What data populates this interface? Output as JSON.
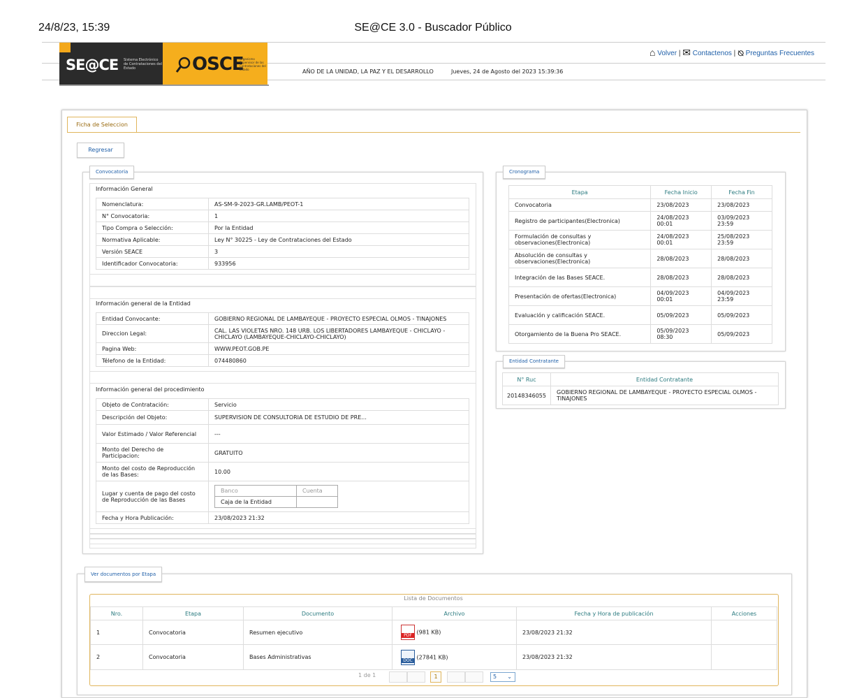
{
  "print": {
    "date": "24/8/23, 15:39",
    "title": "SE@CE 3.0 - Buscador Público"
  },
  "header": {
    "seace_logo": "SE@CE",
    "seace_logo_sub": "Sistema Electrónico de Contrataciones del Estado",
    "osce_logo": "OSCE",
    "osce_logo_sub": "Organismo Supervisor de las Contrataciones del Estado",
    "links": {
      "volver": "Volver",
      "contactenos": "Contactenos",
      "faq": "Preguntas Frecuentes",
      "sep": "|"
    },
    "motto": "AÑO DE LA UNIDAD, LA PAZ Y EL DESARROLLO",
    "datetime": "Jueves, 24 de Agosto del 2023 15:39:36"
  },
  "tab": {
    "label": "Ficha de Seleccion"
  },
  "regresar": "Regresar",
  "convocatoria": {
    "legend": "Convocatoria",
    "general_title": "Información General",
    "general": [
      {
        "k": "Nomenclatura:",
        "v": "AS-SM-9-2023-GR.LAMB/PEOT-1"
      },
      {
        "k": "N° Convocatoria:",
        "v": "1"
      },
      {
        "k": "Tipo Compra o Selección:",
        "v": "Por la Entidad"
      },
      {
        "k": "Normativa Aplicable:",
        "v": "Ley N° 30225 - Ley de Contrataciones del Estado"
      },
      {
        "k": "Versión SEACE",
        "v": "3"
      },
      {
        "k": "Identificador Convocatoria:",
        "v": "933956"
      }
    ],
    "entidad_title": "Información general de la Entidad",
    "entidad": [
      {
        "k": "Entidad Convocante:",
        "v": "GOBIERNO REGIONAL DE LAMBAYEQUE - PROYECTO ESPECIAL OLMOS - TINAJONES"
      },
      {
        "k": "Direccion Legal:",
        "v": "CAL. LAS VIOLETAS NRO. 148 URB. LOS LIBERTADORES LAMBAYEQUE - CHICLAYO - CHICLAYO (LAMBAYEQUE-CHICLAYO-CHICLAYO)"
      },
      {
        "k": "Pagina Web:",
        "v": "WWW.PEOT.GOB.PE"
      },
      {
        "k": "Télefono de la Entidad:",
        "v": "074480860"
      }
    ],
    "proc_title": "Información general del procedimiento",
    "proc": [
      {
        "k": "Objeto de Contratación:",
        "v": "Servicio"
      },
      {
        "k": "Descripción del Objeto:",
        "v": "SUPERVISION DE CONSULTORIA DE ESTUDIO DE PRE..."
      },
      {
        "k": "Valor Estimado / Valor Referencial",
        "v": "---"
      },
      {
        "k": "Monto del Derecho de Participacion:",
        "v": "GRATUITO"
      },
      {
        "k": "Monto del costo de Reproducción de las Bases:",
        "v": "10.00"
      },
      {
        "k": "Lugar y cuenta de pago del costo de Reproducción de las Bases",
        "v": ""
      },
      {
        "k": "Fecha y Hora Publicación:",
        "v": "23/08/2023 21:32"
      }
    ],
    "pago": {
      "h_banco": "Banco",
      "h_cuenta": "Cuenta",
      "banco": "Caja de la Entidad",
      "cuenta": ""
    }
  },
  "cronograma": {
    "legend": "Cronograma",
    "headers": [
      "Etapa",
      "Fecha Inicio",
      "Fecha Fin"
    ],
    "rows": [
      [
        "Convocatoria",
        "23/08/2023",
        "23/08/2023"
      ],
      [
        "Registro de participantes(Electronica)",
        "24/08/2023 00:01",
        "03/09/2023 23:59"
      ],
      [
        "Formulación de consultas y observaciones(Electronica)",
        "24/08/2023 00:01",
        "25/08/2023 23:59"
      ],
      [
        "Absolución de consultas y observaciones(Electronica)",
        "28/08/2023",
        "28/08/2023"
      ],
      [
        "Integración de las Bases SEACE.",
        "28/08/2023",
        "28/08/2023"
      ],
      [
        "Presentación de ofertas(Electronica)",
        "04/09/2023 00:01",
        "04/09/2023 23:59"
      ],
      [
        "Evaluación y calificación SEACE.",
        "05/09/2023",
        "05/09/2023"
      ],
      [
        "Otorgamiento de la Buena Pro SEACE.",
        "05/09/2023 08:30",
        "05/09/2023"
      ]
    ]
  },
  "entidad_contratante": {
    "legend": "Entidad Contratante",
    "headers": [
      "N° Ruc",
      "Entidad Contratante"
    ],
    "ruc": "20148346055",
    "nombre": "GOBIERNO REGIONAL DE LAMBAYEQUE - PROYECTO ESPECIAL OLMOS - TINAJONES"
  },
  "documentos": {
    "legend": "Ver documentos por Etapa",
    "list_title": "Lista de Documentos",
    "headers": [
      "Nro.",
      "Etapa",
      "Documento",
      "Archivo",
      "Fecha y Hora de publicación",
      "Acciones"
    ],
    "rows": [
      {
        "nro": "1",
        "etapa": "Convocatoria",
        "doc": "Resumen ejecutivo",
        "icon": "PDF",
        "size": "(981 KB)",
        "fecha": "23/08/2023 21:32"
      },
      {
        "nro": "2",
        "etapa": "Convocatoria",
        "doc": "Bases Administrativas",
        "icon": "DOC",
        "size": "(27841 KB)",
        "fecha": "23/08/2023 21:32"
      }
    ],
    "pager": {
      "info": "1 de 1",
      "current": "1",
      "per_page": "5"
    }
  },
  "colors": {
    "accent": "#f5ae1d",
    "link": "#1f5fa8",
    "header_teal": "#2a7a7f"
  }
}
